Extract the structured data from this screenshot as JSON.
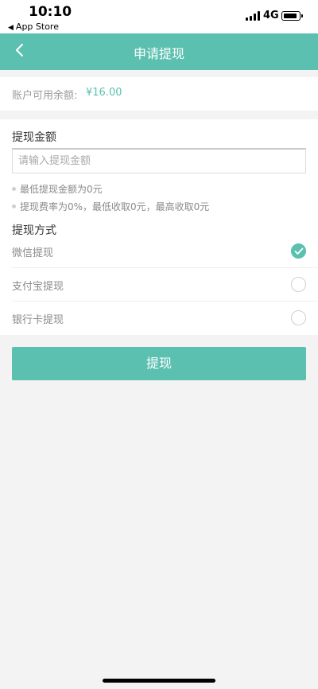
{
  "status_bar": {
    "time": "10:10",
    "back_app": "App Store",
    "network": "4G"
  },
  "nav": {
    "title": "申请提现",
    "back_icon": "chevron-left-icon"
  },
  "balance": {
    "label": "账户可用余额:",
    "value": "¥16.00"
  },
  "amount": {
    "section_title": "提现金额",
    "placeholder": "请输入提现金额",
    "value": ""
  },
  "tips": [
    "最低提现金额为0元",
    "提现费率为0%，最低收取0元，最高收取0元"
  ],
  "method": {
    "section_title": "提现方式",
    "options": [
      {
        "label": "微信提现",
        "selected": true
      },
      {
        "label": "支付宝提现",
        "selected": false
      },
      {
        "label": "银行卡提现",
        "selected": false
      }
    ]
  },
  "submit_label": "提现",
  "colors": {
    "accent": "#5bc0b0",
    "background": "#f3f3f3"
  }
}
